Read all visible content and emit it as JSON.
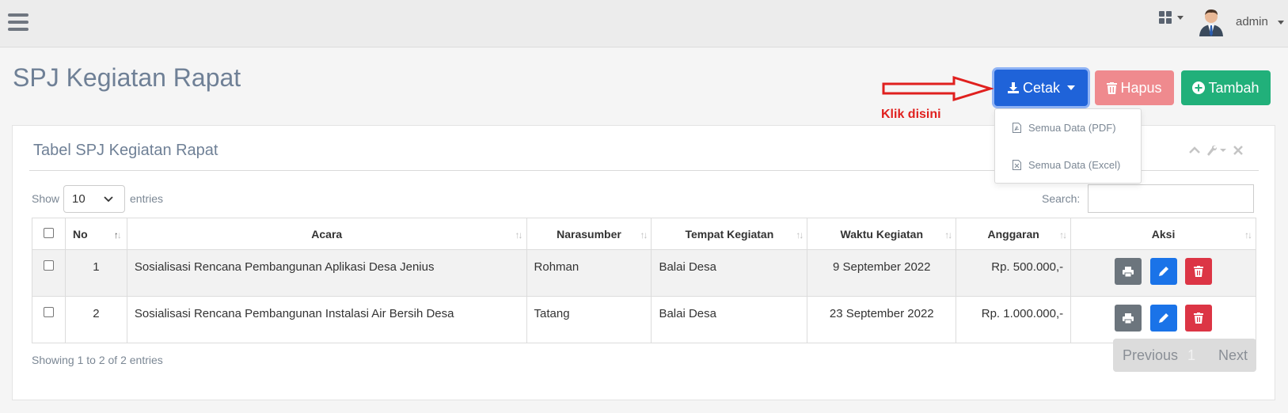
{
  "navbar": {
    "user_name": "admin"
  },
  "page": {
    "title": "SPJ Kegiatan Rapat"
  },
  "toolbar": {
    "cetak_label": "Cetak",
    "hapus_label": "Hapus",
    "tambah_label": "Tambah"
  },
  "annotation": {
    "text": "Klik disini",
    "color": "#e0201e"
  },
  "dropdown": {
    "items": [
      {
        "label": "Semua Data (PDF)",
        "icon": "file-pdf-icon"
      },
      {
        "label": "Semua Data (Excel)",
        "icon": "file-excel-icon"
      }
    ]
  },
  "panel": {
    "title": "Tabel SPJ Kegiatan Rapat",
    "show_label": "Show",
    "page_length": "10",
    "entries_label": "entries",
    "search_label": "Search:",
    "search_value": ""
  },
  "table": {
    "headers": [
      "No",
      "Acara",
      "Narasumber",
      "Tempat Kegiatan",
      "Waktu Kegiatan",
      "Anggaran",
      "Aksi"
    ],
    "rows": [
      {
        "no": "1",
        "acara": "Sosialisasi Rencana Pembangunan Aplikasi Desa Jenius",
        "narasumber": "Rohman",
        "tempat": "Balai Desa",
        "waktu": "9 September 2022",
        "anggaran": "Rp. 500.000,-"
      },
      {
        "no": "2",
        "acara": "Sosialisasi Rencana Pembangunan Instalasi Air Bersih Desa",
        "narasumber": "Tatang",
        "tempat": "Balai Desa",
        "waktu": "23 September 2022",
        "anggaran": "Rp. 1.000.000,-"
      }
    ]
  },
  "footer": {
    "info": "Showing 1 to 2 of 2 entries",
    "previous": "Previous",
    "page": "1",
    "next": "Next"
  },
  "colors": {
    "cetak": "#1f63d9",
    "hapus": "#ef8a8e",
    "tambah": "#21b07a",
    "print_action": "#6c757d",
    "edit_action": "#1a73e8",
    "delete_action": "#dc3545"
  }
}
